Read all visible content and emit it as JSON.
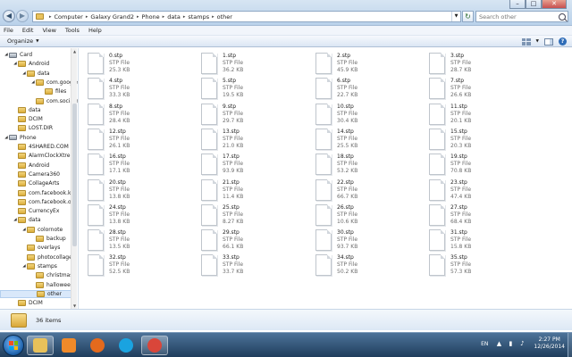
{
  "address": {
    "crumbs": [
      "Computer",
      "Galaxy Grand2",
      "Phone",
      "data",
      "stamps",
      "other"
    ]
  },
  "search": {
    "placeholder": "Search other"
  },
  "window_buttons": {
    "minimize": "–",
    "maximize": "□",
    "close": "✕"
  },
  "menu": [
    "File",
    "Edit",
    "View",
    "Tools",
    "Help"
  ],
  "toolbar": {
    "organize_label": "Organize"
  },
  "nav_tree": [
    {
      "label": "Card",
      "level": 0,
      "type": "drive",
      "expanded": true
    },
    {
      "label": "Android",
      "level": 1,
      "type": "folder",
      "expanded": true
    },
    {
      "label": "data",
      "level": 2,
      "type": "folder",
      "expanded": true
    },
    {
      "label": "com.google",
      "level": 3,
      "type": "folder",
      "expanded": true
    },
    {
      "label": "files",
      "level": 4,
      "type": "folder",
      "expanded": false
    },
    {
      "label": "com.socialn",
      "level": 3,
      "type": "folder",
      "expanded": false
    },
    {
      "label": "data",
      "level": 1,
      "type": "folder",
      "expanded": false
    },
    {
      "label": "DCIM",
      "level": 1,
      "type": "folder",
      "expanded": false
    },
    {
      "label": "LOST.DIR",
      "level": 1,
      "type": "folder",
      "expanded": false
    },
    {
      "label": "Phone",
      "level": 0,
      "type": "drive",
      "expanded": true
    },
    {
      "label": "4SHARED.COM",
      "level": 1,
      "type": "folder",
      "expanded": false
    },
    {
      "label": "AlarmClockXtre",
      "level": 1,
      "type": "folder",
      "expanded": false
    },
    {
      "label": "Android",
      "level": 1,
      "type": "folder",
      "expanded": false
    },
    {
      "label": "Camera360",
      "level": 1,
      "type": "folder",
      "expanded": false
    },
    {
      "label": "CollageArts",
      "level": 1,
      "type": "folder",
      "expanded": false
    },
    {
      "label": "com.facebook.k",
      "level": 1,
      "type": "folder",
      "expanded": false
    },
    {
      "label": "com.facebook.o",
      "level": 1,
      "type": "folder",
      "expanded": false
    },
    {
      "label": "CurrencyEx",
      "level": 1,
      "type": "folder",
      "expanded": false
    },
    {
      "label": "data",
      "level": 1,
      "type": "folder",
      "expanded": true
    },
    {
      "label": "colornote",
      "level": 2,
      "type": "folder",
      "expanded": true
    },
    {
      "label": "backup",
      "level": 3,
      "type": "folder",
      "expanded": false
    },
    {
      "label": "overlays",
      "level": 2,
      "type": "folder",
      "expanded": false
    },
    {
      "label": "photocollages",
      "level": 2,
      "type": "folder",
      "expanded": false
    },
    {
      "label": "stamps",
      "level": 2,
      "type": "folder",
      "expanded": true
    },
    {
      "label": "christmas",
      "level": 3,
      "type": "folder",
      "expanded": false
    },
    {
      "label": "halloween",
      "level": 3,
      "type": "folder",
      "expanded": false
    },
    {
      "label": "other",
      "level": 3,
      "type": "folder",
      "expanded": false,
      "selected": true
    },
    {
      "label": "DCIM",
      "level": 1,
      "type": "folder",
      "expanded": false
    }
  ],
  "files": [
    {
      "name": "0.stp",
      "type": "STP File",
      "size": "25.3 KB"
    },
    {
      "name": "1.stp",
      "type": "STP File",
      "size": "36.2 KB"
    },
    {
      "name": "2.stp",
      "type": "STP File",
      "size": "45.9 KB"
    },
    {
      "name": "3.stp",
      "type": "STP File",
      "size": "28.7 KB"
    },
    {
      "name": "4.stp",
      "type": "STP File",
      "size": "33.3 KB"
    },
    {
      "name": "5.stp",
      "type": "STP File",
      "size": "19.5 KB"
    },
    {
      "name": "6.stp",
      "type": "STP File",
      "size": "22.7 KB"
    },
    {
      "name": "7.stp",
      "type": "STP File",
      "size": "26.6 KB"
    },
    {
      "name": "8.stp",
      "type": "STP File",
      "size": "28.4 KB"
    },
    {
      "name": "9.stp",
      "type": "STP File",
      "size": "29.7 KB"
    },
    {
      "name": "10.stp",
      "type": "STP File",
      "size": "30.4 KB"
    },
    {
      "name": "11.stp",
      "type": "STP File",
      "size": "20.1 KB"
    },
    {
      "name": "12.stp",
      "type": "STP File",
      "size": "26.1 KB"
    },
    {
      "name": "13.stp",
      "type": "STP File",
      "size": "21.0 KB"
    },
    {
      "name": "14.stp",
      "type": "STP File",
      "size": "25.5 KB"
    },
    {
      "name": "15.stp",
      "type": "STP File",
      "size": "20.3 KB"
    },
    {
      "name": "16.stp",
      "type": "STP File",
      "size": "17.1 KB"
    },
    {
      "name": "17.stp",
      "type": "STP File",
      "size": "93.9 KB"
    },
    {
      "name": "18.stp",
      "type": "STP File",
      "size": "53.2 KB"
    },
    {
      "name": "19.stp",
      "type": "STP File",
      "size": "70.8 KB"
    },
    {
      "name": "20.stp",
      "type": "STP File",
      "size": "13.8 KB"
    },
    {
      "name": "21.stp",
      "type": "STP File",
      "size": "11.4 KB"
    },
    {
      "name": "22.stp",
      "type": "STP File",
      "size": "66.7 KB"
    },
    {
      "name": "23.stp",
      "type": "STP File",
      "size": "47.4 KB"
    },
    {
      "name": "24.stp",
      "type": "STP File",
      "size": "13.8 KB"
    },
    {
      "name": "25.stp",
      "type": "STP File",
      "size": "8.27 KB"
    },
    {
      "name": "26.stp",
      "type": "STP File",
      "size": "10.6 KB"
    },
    {
      "name": "27.stp",
      "type": "STP File",
      "size": "68.4 KB"
    },
    {
      "name": "28.stp",
      "type": "STP File",
      "size": "13.5 KB"
    },
    {
      "name": "29.stp",
      "type": "STP File",
      "size": "66.1 KB"
    },
    {
      "name": "30.stp",
      "type": "STP File",
      "size": "93.7 KB"
    },
    {
      "name": "31.stp",
      "type": "STP File",
      "size": "15.8 KB"
    },
    {
      "name": "32.stp",
      "type": "STP File",
      "size": "52.5 KB"
    },
    {
      "name": "33.stp",
      "type": "STP File",
      "size": "33.7 KB"
    },
    {
      "name": "34.stp",
      "type": "STP File",
      "size": "50.2 KB"
    },
    {
      "name": "35.stp",
      "type": "STP File",
      "size": "57.3 KB"
    }
  ],
  "status": {
    "item_count": "36 items"
  },
  "taskbar": {
    "apps": [
      {
        "name": "explorer",
        "icon": "folder-icon",
        "color": "#e8c15a",
        "active": true
      },
      {
        "name": "media",
        "icon": "media-player-icon",
        "color": "#f08a2a",
        "active": false
      },
      {
        "name": "firefox",
        "icon": "firefox-icon",
        "color": "#e46a1d",
        "active": false
      },
      {
        "name": "skype",
        "icon": "skype-icon",
        "color": "#1aa3e0",
        "active": false
      },
      {
        "name": "chrome",
        "icon": "chrome-icon",
        "color": "#d9463a",
        "active": true
      }
    ],
    "lang": "EN",
    "time": "2:27 PM",
    "date": "12/26/2014"
  }
}
